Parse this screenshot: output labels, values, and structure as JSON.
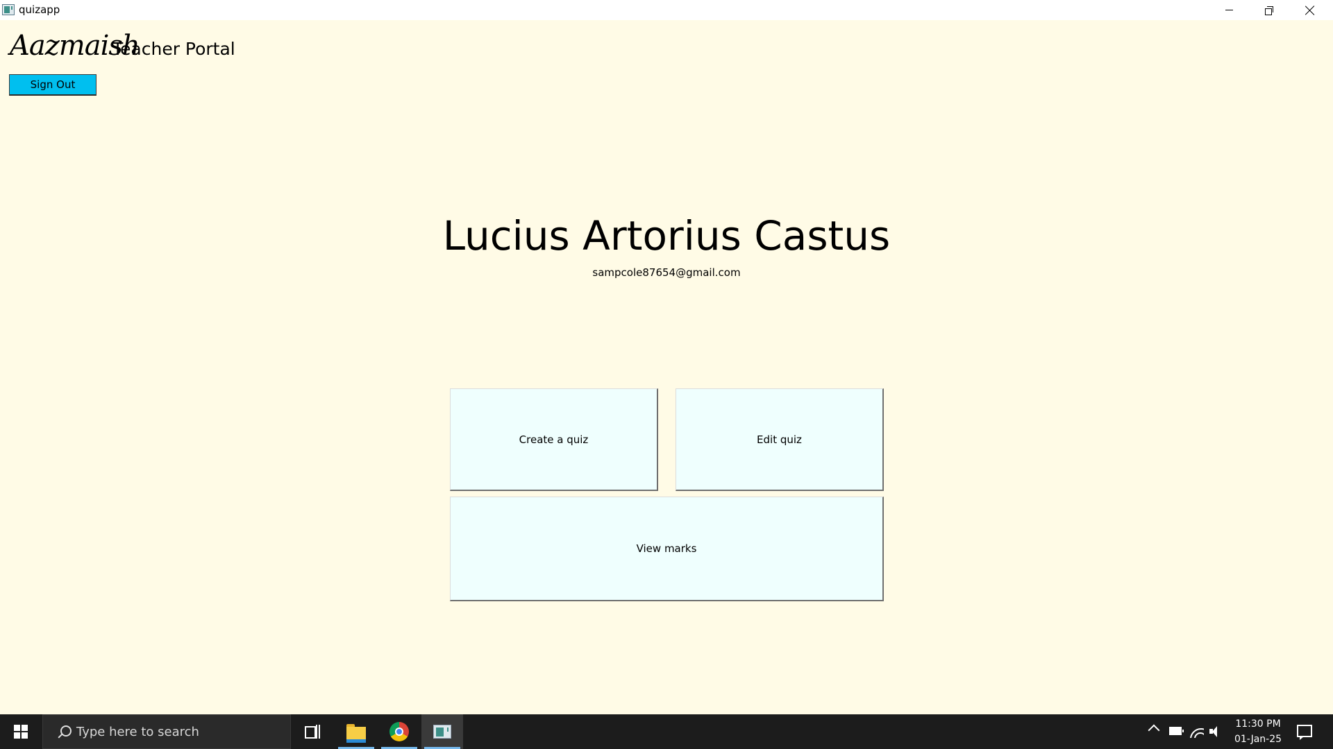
{
  "window": {
    "title": "quizapp",
    "app_icon": "quizapp-icon",
    "controls": [
      "minimize-icon",
      "maximize-icon",
      "close-icon"
    ]
  },
  "header": {
    "brand": "Aazmaish",
    "portal": "Teacher Portal",
    "sign_out_label": "Sign Out",
    "sign_out_color": "#00bfef"
  },
  "user": {
    "name": "Lucius Artorius Castus",
    "email": "sampcole87654@gmail.com"
  },
  "actions": {
    "create_quiz": "Create a quiz",
    "edit_quiz": "Edit quiz",
    "view_marks": "View marks"
  },
  "taskbar": {
    "search_placeholder": "Type here to search",
    "apps": [
      "task-view-icon",
      "file-explorer-icon",
      "chrome-icon",
      "quizapp-icon"
    ],
    "time": "11:30 PM",
    "date": "01-Jan-25"
  },
  "colors": {
    "background": "#fffbe6",
    "tile": "#effffe",
    "taskbar": "#1c1c1c"
  }
}
